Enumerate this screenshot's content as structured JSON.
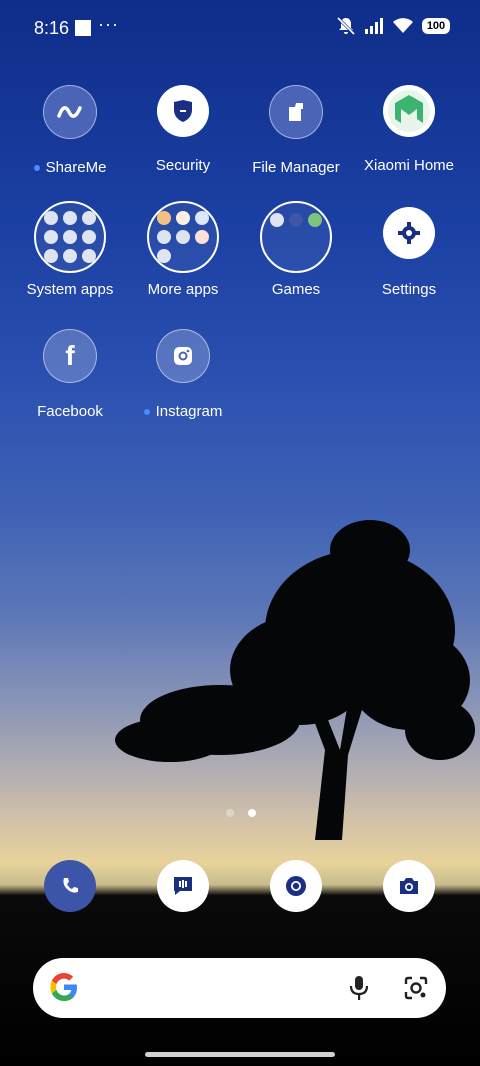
{
  "status_bar": {
    "time": "8:16",
    "more": "···",
    "battery": "100"
  },
  "apps": {
    "shareme": "ShareMe",
    "security": "Security",
    "file_manager": "File Manager",
    "xiaomi_home": "Xiaomi Home",
    "system_apps": "System apps",
    "more_apps": "More apps",
    "games": "Games",
    "settings": "Settings",
    "facebook": "Facebook",
    "instagram": "Instagram"
  },
  "pager": {
    "pages": 2,
    "active": 2
  },
  "dock": [
    "phone-icon",
    "messages-icon",
    "chrome-icon",
    "camera-icon"
  ],
  "search": {
    "left_icon": "google-g-icon",
    "right_icons": [
      "mic-icon",
      "lens-icon"
    ]
  },
  "colors": {
    "accent": "#3d55a8",
    "new_dot": "#4a8cff"
  }
}
